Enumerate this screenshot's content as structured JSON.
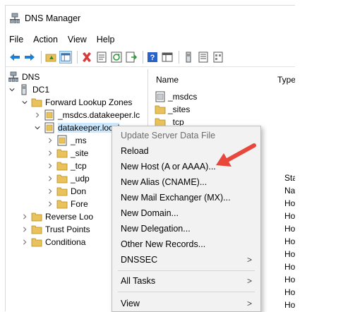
{
  "window": {
    "title": "DNS Manager"
  },
  "menubar": [
    "File",
    "Action",
    "View",
    "Help"
  ],
  "tree": {
    "root": "DNS",
    "server": "DC1",
    "forward_zones": "Forward Lookup Zones",
    "msdcs_zone": "_msdcs.datakeeper.lc",
    "datakeeper_zone": "datakeeper.local",
    "children": [
      "_ms",
      "_site",
      "_tcp",
      "_udp",
      "Don",
      "Fore"
    ],
    "reverse_zones": "Reverse Loo",
    "trust_points": "Trust Points",
    "conditional": "Conditiona"
  },
  "list": {
    "col_name": "Name",
    "col_type": "Type",
    "rows": [
      "_msdcs",
      "_sites",
      "_tcp"
    ],
    "types": [
      "Start",
      "Nam",
      "Host",
      "Host",
      "Host",
      "Host",
      "Host",
      "Host",
      "Host",
      "Host",
      "Host"
    ]
  },
  "context_menu": {
    "items": [
      "Update Server Data File",
      "Reload",
      "New Host (A or AAAA)...",
      "New Alias (CNAME)...",
      "New Mail Exchanger (MX)...",
      "New Domain...",
      "New Delegation...",
      "Other New Records...",
      "DNSSEC",
      "All Tasks",
      "View"
    ]
  },
  "colors": {
    "arrow": "#e8473b",
    "folder": "#e9c25b",
    "selection": "#cce8ff",
    "menu_bg": "#f2f2f2"
  }
}
